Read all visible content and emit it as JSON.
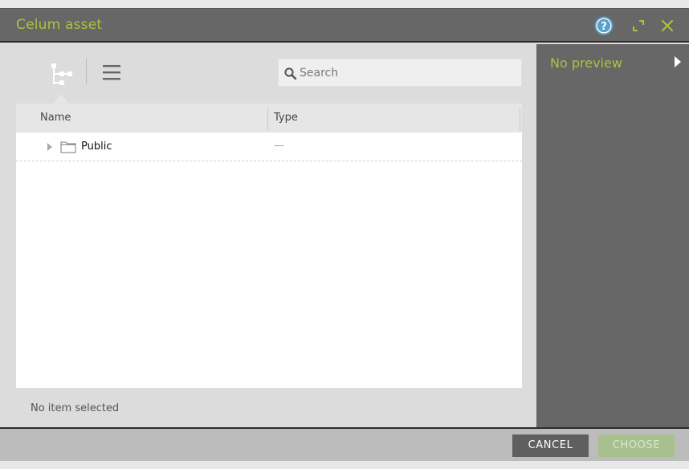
{
  "dialog": {
    "title": "Celum asset",
    "accent_color": "#a8c43c"
  },
  "toolbar": {
    "help_icon": "help-icon",
    "expand_icon": "expand-icon",
    "close_icon": "close-icon",
    "tree_view_icon": "tree-view-icon",
    "list_view_icon": "list-view-icon"
  },
  "search": {
    "placeholder": "Search",
    "value": ""
  },
  "table": {
    "columns": [
      "Name",
      "Type"
    ],
    "rows": [
      {
        "name": "Public",
        "type": "—"
      }
    ]
  },
  "status": {
    "text": "No item selected"
  },
  "preview": {
    "label": "No preview"
  },
  "footer": {
    "cancel_label": "CANCEL",
    "choose_label": "CHOOSE"
  }
}
